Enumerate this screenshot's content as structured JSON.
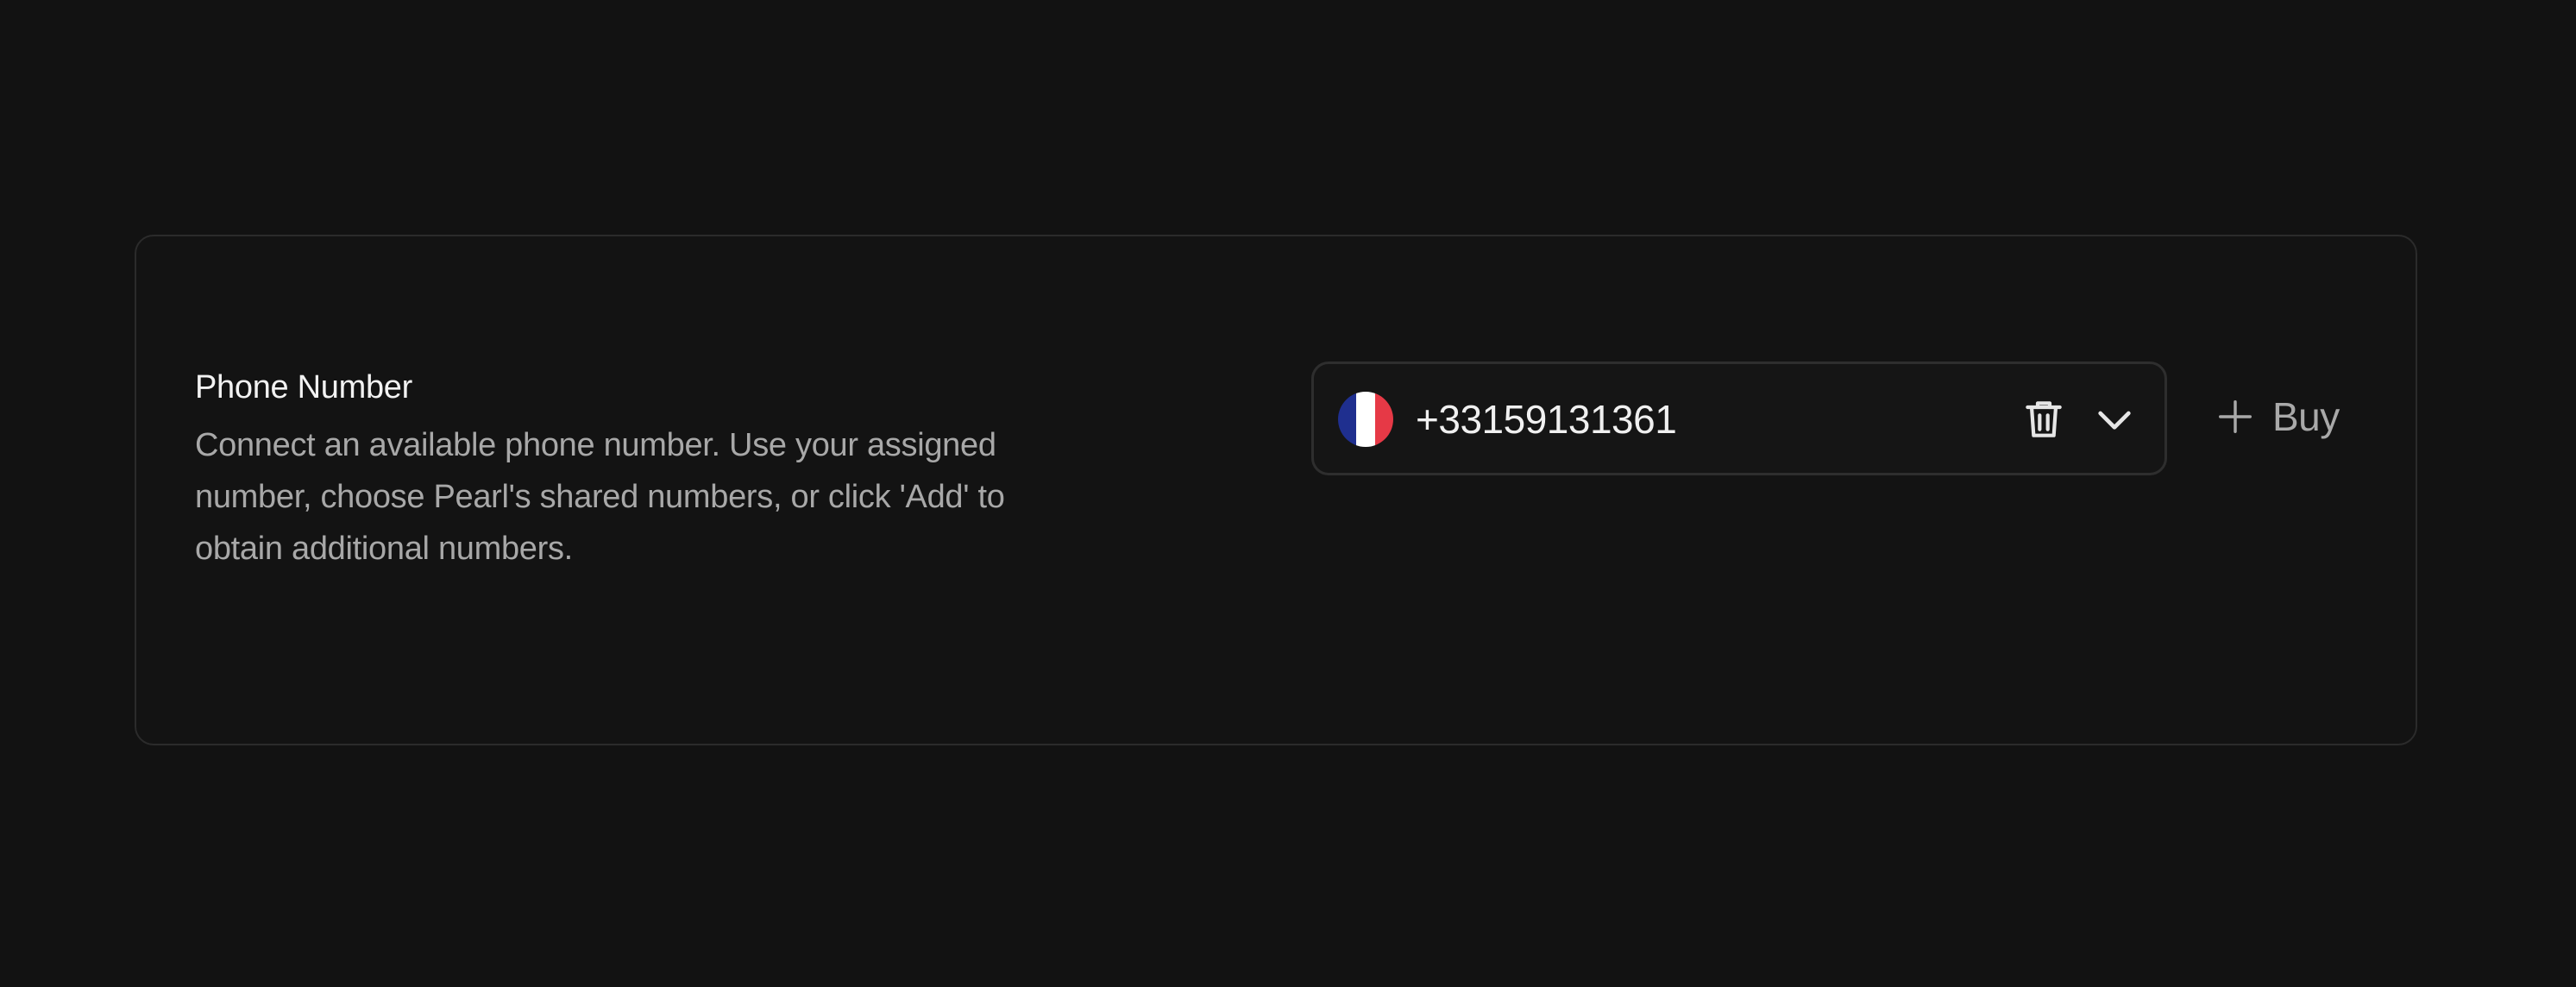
{
  "phone_number_section": {
    "title": "Phone Number",
    "description": "Connect an available phone number. Use your assigned number, choose Pearl's shared numbers, or click 'Add' to obtain additional numbers.",
    "selected_number": "+33159131361",
    "country_flag_icon": "france-flag-icon",
    "flag_colors": [
      "#1f2f8f",
      "#ffffff",
      "#e63946"
    ],
    "delete_icon": "trash-icon",
    "dropdown_icon": "chevron-down-icon",
    "buy_button": {
      "icon": "plus-icon",
      "label": "Buy"
    }
  }
}
